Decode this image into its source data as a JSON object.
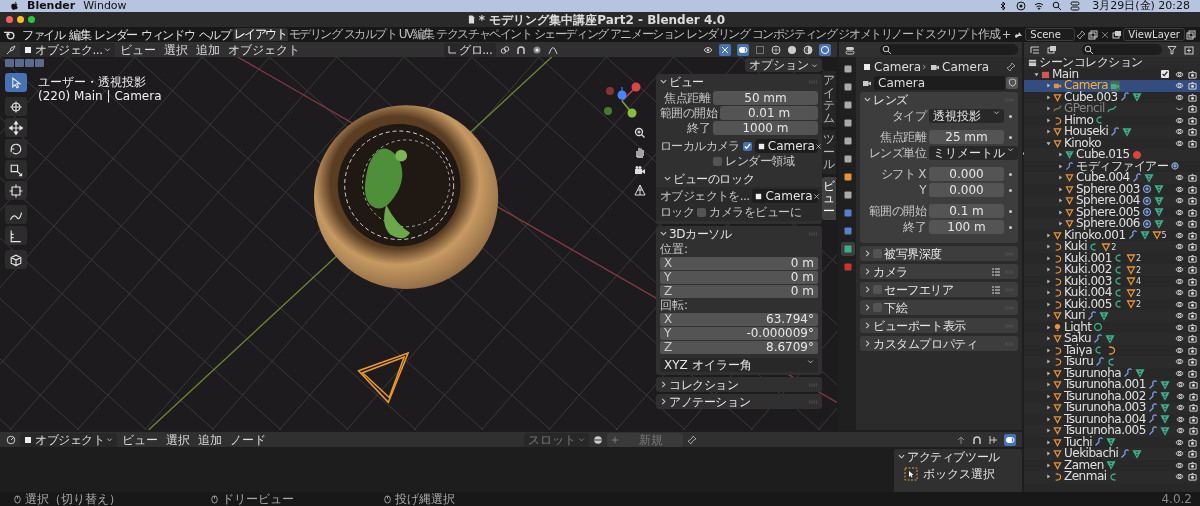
{
  "os_menu_bar": {
    "app_name": "Blender",
    "menus": [
      "Window"
    ],
    "clock": "3月29日(金) 20:28"
  },
  "window": {
    "title": "* モデリング集中講座Part2 - Blender 4.0"
  },
  "top_bar": {
    "menus": [
      "ファイル",
      "編集",
      "レンダー",
      "ウィンドウ",
      "ヘルプ"
    ],
    "workspace_tabs": [
      {
        "label": "レイアウト",
        "selected": true
      },
      {
        "label": "モデリング",
        "selected": false
      },
      {
        "label": "スカルプト",
        "selected": false
      },
      {
        "label": "UV編集",
        "selected": false
      },
      {
        "label": "テクスチャペイント",
        "selected": false
      },
      {
        "label": "シェーディング",
        "selected": false
      },
      {
        "label": "アニメーション",
        "selected": false
      },
      {
        "label": "レンダリング",
        "selected": false
      },
      {
        "label": "コンポジティング",
        "selected": false
      },
      {
        "label": "ジオメトリノード",
        "selected": false
      },
      {
        "label": "スクリプト作成",
        "selected": false
      }
    ],
    "scene": "Scene",
    "view_layer": "ViewLayer"
  },
  "viewport": {
    "mode": "オブジェク...",
    "menus": [
      "ビュー",
      "選択",
      "追加",
      "オブジェクト"
    ],
    "orientation": "グロ...",
    "tools": [
      {
        "selected": true
      },
      {
        "selected": false
      },
      {
        "selected": false
      },
      {
        "selected": false
      },
      {
        "selected": false
      },
      {
        "selected": false
      },
      {
        "selected": false
      },
      {
        "selected": false
      },
      {
        "selected": false
      }
    ],
    "overlay_lines": [
      "ユーザー・透視投影",
      "(220) Main | Camera"
    ],
    "options": "オプション",
    "sidebar_tabs": [
      {
        "label": "アイテム",
        "selected": false
      },
      {
        "label": "ツール",
        "selected": false
      },
      {
        "label": "ビュー",
        "selected": true
      }
    ],
    "sidebar_panels": [
      {
        "kind": "view",
        "title": "ビュー",
        "expanded": true,
        "fields": [
          {
            "label": "焦点距離",
            "value": "50 mm"
          },
          {
            "label": "範囲の開始",
            "value": "0.01 m"
          },
          {
            "label": "終了",
            "value": "1000 m"
          }
        ],
        "local_camera": {
          "label": "ローカルカメラ",
          "checked": true,
          "value": "Camera"
        },
        "render_region": {
          "label": "レンダー領域",
          "checked": false
        },
        "lock": {
          "title": "ビューのロック",
          "expanded": true,
          "object_label": "オブジェクトを...",
          "object_value": "Camera",
          "lock_label": "ロック",
          "lock_option": {
            "label": "カメラをビューに",
            "checked": false
          }
        }
      },
      {
        "kind": "cursor",
        "title": "3Dカーソル",
        "expanded": true,
        "location_label": "位置:",
        "location": [
          {
            "axis": "X",
            "value": "0 m"
          },
          {
            "axis": "Y",
            "value": "0 m"
          },
          {
            "axis": "Z",
            "value": "0 m"
          }
        ],
        "rotation_label": "回転:",
        "rotation": [
          {
            "axis": "X",
            "value": "63.794°"
          },
          {
            "axis": "Y",
            "value": "-0.000009°"
          },
          {
            "axis": "Z",
            "value": "8.6709°"
          }
        ],
        "rotation_mode": "XYZ オイラー角"
      },
      {
        "kind": "generic",
        "title": "コレクション",
        "expanded": false
      },
      {
        "kind": "generic",
        "title": "アノテーション",
        "expanded": false
      }
    ]
  },
  "properties": {
    "tabs": [
      {
        "selected": false
      },
      {
        "selected": false
      },
      {
        "selected": false
      },
      {
        "selected": false
      },
      {
        "selected": false
      },
      {
        "selected": false
      },
      {
        "selected": false
      },
      {
        "selected": false
      },
      {
        "selected": false
      },
      {
        "selected": false
      },
      {
        "selected": true
      },
      {
        "selected": false
      }
    ],
    "breadcrumb": [
      "Camera",
      "Camera"
    ],
    "datablock": "Camera",
    "panels": [
      {
        "title": "レンズ",
        "expanded": true,
        "presets": false,
        "groups": [
          [
            {
              "label": "タイプ",
              "value": "透視投影",
              "kind": "dropdown"
            }
          ],
          [
            {
              "label": "焦点距離",
              "value": "25 mm",
              "kind": "number"
            },
            {
              "label": "レンズ単位",
              "value": "ミリメートル",
              "kind": "dropdown"
            }
          ],
          [
            {
              "label": "シフト X",
              "value": "0.000",
              "kind": "number"
            },
            {
              "label": "Y",
              "value": "0.000",
              "kind": "number"
            }
          ],
          [
            {
              "label": "範囲の開始",
              "value": "0.1 m",
              "kind": "number"
            },
            {
              "label": "終了",
              "value": "100 m",
              "kind": "number"
            }
          ]
        ]
      },
      {
        "title": "被写界深度",
        "expanded": false,
        "checked": false,
        "presets": false
      },
      {
        "title": "カメラ",
        "expanded": false,
        "presets": true
      },
      {
        "title": "セーフエリア",
        "expanded": false,
        "checked": false,
        "presets": true
      },
      {
        "title": "下絵",
        "expanded": false,
        "checked": false,
        "presets": false
      },
      {
        "title": "ビューポート表示",
        "expanded": false,
        "presets": false
      },
      {
        "title": "カスタムプロパティ",
        "expanded": false,
        "presets": false
      }
    ]
  },
  "outliner": {
    "root": "シーンコレクション",
    "tree": [
      {
        "name": "Main",
        "kind": "collection",
        "checked": true,
        "expanded": true,
        "selected": false,
        "visible": true,
        "children": [
          {
            "name": "Camera",
            "kind": "camera",
            "expanded": false,
            "selected": true,
            "visible": true,
            "badges": [
              {
                "kind": "camera-data"
              }
            ]
          },
          {
            "name": "Cube.003",
            "kind": "mesh",
            "expanded": false,
            "selected": false,
            "visible": true,
            "badges": [
              {
                "kind": "wrench"
              },
              {
                "kind": "mesh-data"
              }
            ]
          },
          {
            "name": "GPencil",
            "kind": "gpencil",
            "expanded": false,
            "selected": false,
            "visible": false,
            "badges": [
              {
                "kind": "gpencil-data"
              }
            ]
          },
          {
            "name": "Himo",
            "kind": "curve",
            "expanded": false,
            "selected": false,
            "visible": true,
            "badges": [
              {
                "kind": "curve-data"
              }
            ]
          },
          {
            "name": "Houseki",
            "kind": "mesh",
            "expanded": false,
            "selected": false,
            "visible": true,
            "badges": [
              {
                "kind": "wrench"
              },
              {
                "kind": "mesh-data"
              }
            ]
          },
          {
            "name": "Kinoko",
            "kind": "mesh",
            "expanded": true,
            "selected": false,
            "visible": true,
            "children": [
              {
                "name": "Cube.015",
                "kind": "mesh-data",
                "expanded": false,
                "selected": false,
                "badges": [
                  {
                    "kind": "material"
                  }
                ]
              },
              {
                "name": "モディファイアー",
                "kind": "wrench",
                "expanded": false,
                "selected": false,
                "badges": [
                  {
                    "kind": "gear"
                  }
                ]
              },
              {
                "name": "Cube.004",
                "kind": "mesh",
                "expanded": false,
                "selected": false,
                "visible": true,
                "badges": [
                  {
                    "kind": "wrench"
                  },
                  {
                    "kind": "mesh-data"
                  }
                ]
              },
              {
                "name": "Sphere.003",
                "kind": "mesh",
                "expanded": false,
                "selected": false,
                "visible": true,
                "badges": [
                  {
                    "kind": "particles"
                  },
                  {
                    "kind": "mesh-data"
                  }
                ]
              },
              {
                "name": "Sphere.004",
                "kind": "mesh",
                "expanded": false,
                "selected": false,
                "visible": true,
                "badges": [
                  {
                    "kind": "particles"
                  },
                  {
                    "kind": "mesh-data"
                  }
                ]
              },
              {
                "name": "Sphere.005",
                "kind": "mesh",
                "expanded": false,
                "selected": false,
                "visible": true,
                "badges": [
                  {
                    "kind": "particles"
                  },
                  {
                    "kind": "mesh-data"
                  }
                ]
              },
              {
                "name": "Sphere.006",
                "kind": "mesh",
                "expanded": false,
                "selected": false,
                "visible": true,
                "badges": [
                  {
                    "kind": "particles"
                  },
                  {
                    "kind": "mesh-data"
                  }
                ]
              }
            ]
          },
          {
            "name": "Kinoko.001",
            "kind": "mesh",
            "expanded": false,
            "selected": false,
            "visible": true,
            "badges": [
              {
                "kind": "wrench"
              },
              {
                "kind": "mesh-data"
              },
              {
                "kind": "mesh",
                "count": "5"
              }
            ]
          },
          {
            "name": "Kuki",
            "kind": "curve",
            "expanded": false,
            "selected": false,
            "visible": true,
            "badges": [
              {
                "kind": "curve-data"
              },
              {
                "kind": "mesh",
                "count": "2"
              }
            ]
          },
          {
            "name": "Kuki.001",
            "kind": "curve",
            "expanded": false,
            "selected": false,
            "visible": true,
            "badges": [
              {
                "kind": "curve-data"
              },
              {
                "kind": "mesh",
                "count": "2"
              }
            ]
          },
          {
            "name": "Kuki.002",
            "kind": "curve",
            "expanded": false,
            "selected": false,
            "visible": true,
            "badges": [
              {
                "kind": "curve-data"
              },
              {
                "kind": "mesh",
                "count": "2"
              }
            ]
          },
          {
            "name": "Kuki.003",
            "kind": "curve",
            "expanded": false,
            "selected": false,
            "visible": true,
            "badges": [
              {
                "kind": "curve-data"
              },
              {
                "kind": "mesh",
                "count": "4"
              }
            ]
          },
          {
            "name": "Kuki.004",
            "kind": "curve",
            "expanded": false,
            "selected": false,
            "visible": true,
            "badges": [
              {
                "kind": "curve-data"
              },
              {
                "kind": "mesh",
                "count": "2"
              }
            ]
          },
          {
            "name": "Kuki.005",
            "kind": "curve",
            "expanded": false,
            "selected": false,
            "visible": true,
            "badges": [
              {
                "kind": "curve-data"
              },
              {
                "kind": "mesh",
                "count": "2"
              }
            ]
          },
          {
            "name": "Kuri",
            "kind": "mesh",
            "expanded": false,
            "selected": false,
            "visible": true,
            "badges": [
              {
                "kind": "wrench"
              },
              {
                "kind": "mesh-data"
              }
            ]
          },
          {
            "name": "Light",
            "kind": "light",
            "expanded": false,
            "selected": false,
            "visible": true,
            "badges": [
              {
                "kind": "light-data"
              }
            ]
          },
          {
            "name": "Saku",
            "kind": "mesh",
            "expanded": false,
            "selected": false,
            "visible": true,
            "badges": [
              {
                "kind": "wrench"
              },
              {
                "kind": "mesh-data"
              }
            ]
          },
          {
            "name": "Taiya",
            "kind": "curve",
            "expanded": false,
            "selected": false,
            "visible": true,
            "badges": [
              {
                "kind": "curve-data"
              },
              {
                "kind": "curve"
              }
            ]
          },
          {
            "name": "Tsuru",
            "kind": "curve",
            "expanded": false,
            "selected": false,
            "visible": true,
            "badges": [
              {
                "kind": "wrench"
              },
              {
                "kind": "curve-data"
              }
            ]
          },
          {
            "name": "Tsurunoha",
            "kind": "mesh",
            "expanded": false,
            "selected": false,
            "visible": true,
            "badges": [
              {
                "kind": "wrench"
              },
              {
                "kind": "mesh-data"
              }
            ]
          },
          {
            "name": "Tsurunoha.001",
            "kind": "mesh",
            "expanded": false,
            "selected": false,
            "visible": true,
            "badges": [
              {
                "kind": "wrench"
              },
              {
                "kind": "mesh-data"
              }
            ]
          },
          {
            "name": "Tsurunoha.002",
            "kind": "mesh",
            "expanded": false,
            "selected": false,
            "visible": true,
            "badges": [
              {
                "kind": "wrench"
              },
              {
                "kind": "mesh-data"
              }
            ]
          },
          {
            "name": "Tsurunoha.003",
            "kind": "mesh",
            "expanded": false,
            "selected": false,
            "visible": true,
            "badges": [
              {
                "kind": "wrench"
              },
              {
                "kind": "mesh-data"
              }
            ]
          },
          {
            "name": "Tsurunoha.004",
            "kind": "mesh",
            "expanded": false,
            "selected": false,
            "visible": true,
            "badges": [
              {
                "kind": "wrench"
              },
              {
                "kind": "mesh-data"
              }
            ]
          },
          {
            "name": "Tsurunoha.005",
            "kind": "mesh",
            "expanded": false,
            "selected": false,
            "visible": true,
            "badges": [
              {
                "kind": "wrench"
              },
              {
                "kind": "mesh-data"
              }
            ]
          },
          {
            "name": "Tuchi",
            "kind": "mesh",
            "expanded": false,
            "selected": false,
            "visible": true,
            "badges": [
              {
                "kind": "wrench"
              },
              {
                "kind": "mesh-data"
              }
            ]
          },
          {
            "name": "Uekibachi",
            "kind": "mesh",
            "expanded": false,
            "selected": false,
            "visible": true,
            "badges": [
              {
                "kind": "wrench"
              },
              {
                "kind": "mesh-data"
              }
            ]
          },
          {
            "name": "Zamen",
            "kind": "mesh",
            "expanded": false,
            "selected": false,
            "visible": true,
            "badges": [
              {
                "kind": "mesh-data"
              }
            ]
          },
          {
            "name": "Zenmai",
            "kind": "curve",
            "expanded": false,
            "selected": false,
            "visible": true,
            "badges": [
              {
                "kind": "curve-data"
              }
            ]
          }
        ]
      }
    ]
  },
  "shader_editor": {
    "mode": "オブジェクト",
    "menus": [
      "ビュー",
      "選択",
      "追加",
      "ノード"
    ],
    "slot": {
      "label": "スロット",
      "disabled": true
    },
    "new_button": {
      "label": "新規",
      "disabled": true
    }
  },
  "active_tool": {
    "title": "アクティブツール",
    "tool": "ボックス選択"
  },
  "status_bar": {
    "hints": [
      "選択（切り替え）",
      "ドリービュー",
      "投げ縄選択"
    ],
    "version": "4.0.2"
  }
}
